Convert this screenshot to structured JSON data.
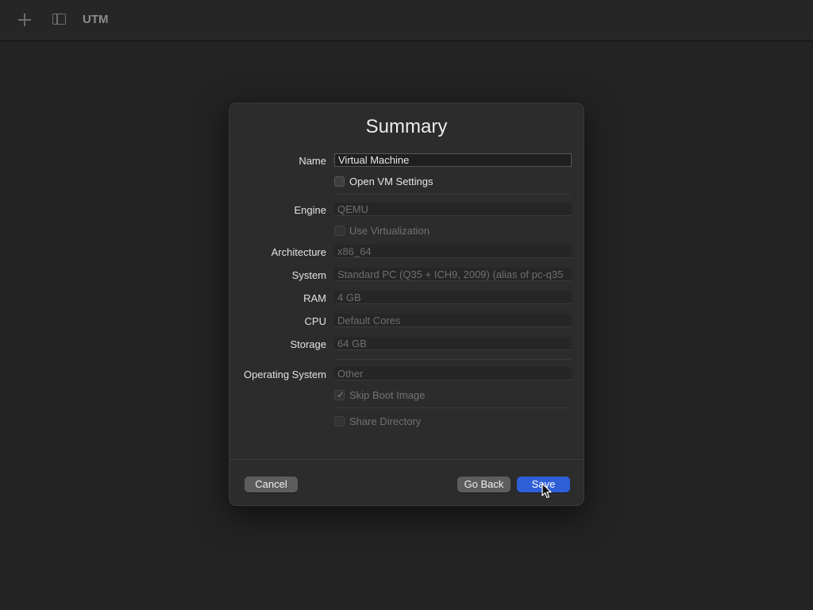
{
  "toolbar": {
    "title": "UTM",
    "add_icon": "plus-icon",
    "sidebar_icon": "sidebar-toggle-icon"
  },
  "dialog": {
    "title": "Summary",
    "name_label": "Name",
    "name_value": "Virtual Machine",
    "open_settings_label": "Open VM Settings",
    "open_settings_checked": false,
    "engine_label": "Engine",
    "engine_value": "QEMU",
    "use_virtualization_label": "Use Virtualization",
    "use_virtualization_checked": false,
    "architecture_label": "Architecture",
    "architecture_value": "x86_64",
    "system_label": "System",
    "system_value": "Standard PC (Q35 + ICH9, 2009) (alias of pc-q35",
    "ram_label": "RAM",
    "ram_value": "4 GB",
    "cpu_label": "CPU",
    "cpu_value": "Default Cores",
    "storage_label": "Storage",
    "storage_value": "64 GB",
    "os_label": "Operating System",
    "os_value": "Other",
    "skip_boot_label": "Skip Boot Image",
    "skip_boot_checked": true,
    "share_dir_label": "Share Directory",
    "share_dir_checked": false,
    "cancel_label": "Cancel",
    "go_back_label": "Go Back",
    "save_label": "Save"
  },
  "colors": {
    "accent": "#2f5fd6",
    "background": "#232323",
    "dialog": "#2c2c2c"
  }
}
